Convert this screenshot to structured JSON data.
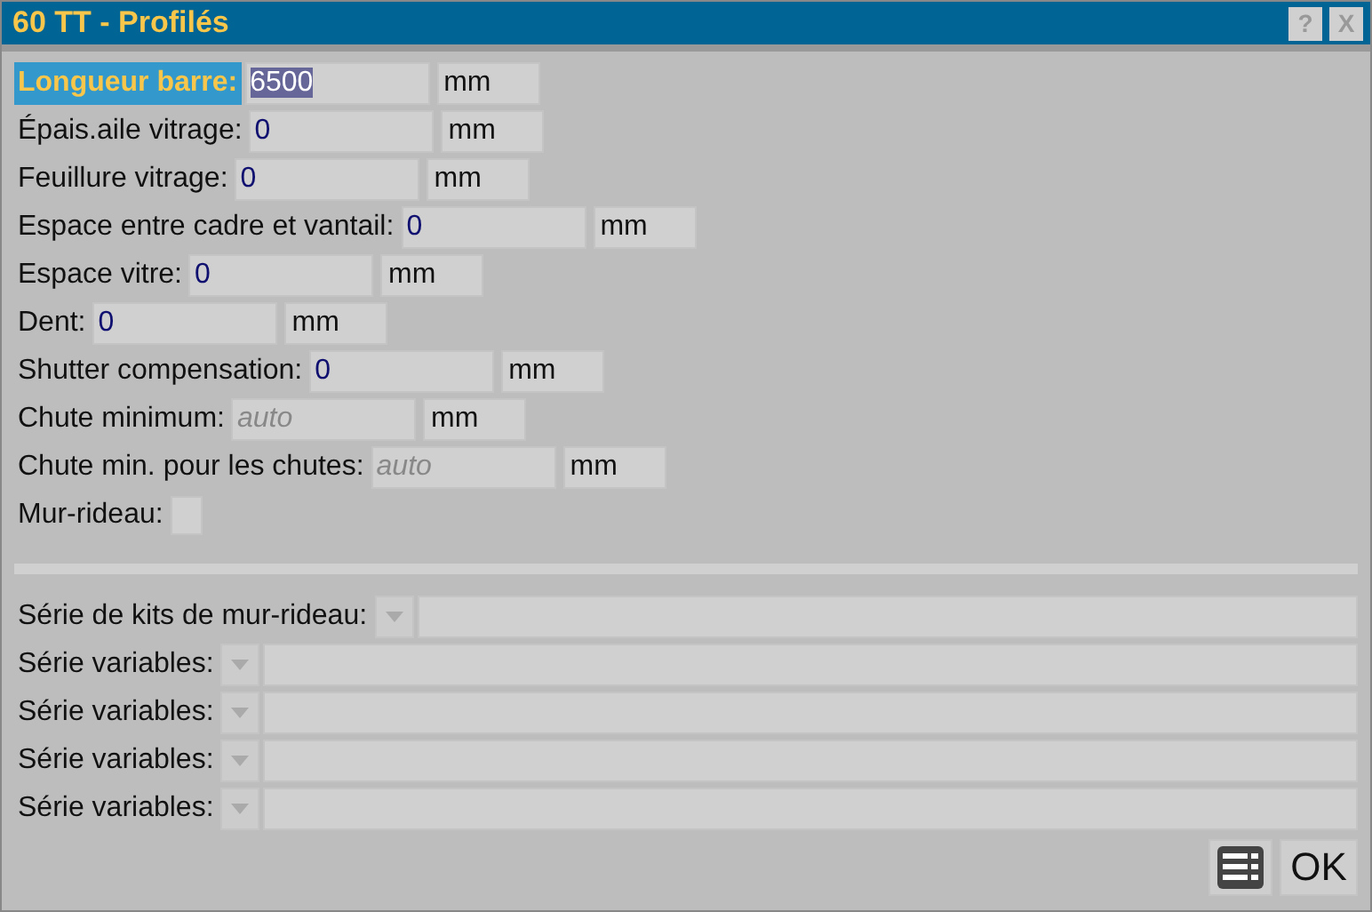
{
  "window": {
    "title": "60 TT - Profilés",
    "help": "?",
    "close": "X"
  },
  "fields": [
    {
      "kind": "number",
      "label": "Longueur barre:",
      "value": "6500",
      "unit": "mm",
      "selected": true
    },
    {
      "kind": "number",
      "label": "Épais.aile vitrage:",
      "value": "0",
      "unit": "mm",
      "selected": false
    },
    {
      "kind": "number",
      "label": "Feuillure vitrage:",
      "value": "0",
      "unit": "mm",
      "selected": false
    },
    {
      "kind": "number",
      "label": "Espace entre cadre et vantail:",
      "value": "0",
      "unit": "mm",
      "selected": false
    },
    {
      "kind": "number",
      "label": "Espace vitre:",
      "value": "0",
      "unit": "mm",
      "selected": false
    },
    {
      "kind": "number",
      "label": "Dent:",
      "value": "0",
      "unit": "mm",
      "selected": false
    },
    {
      "kind": "number",
      "label": "Shutter compensation:",
      "value": "0",
      "unit": "mm",
      "selected": false
    },
    {
      "kind": "number",
      "label": "Chute minimum:",
      "placeholder": "auto",
      "unit": "mm",
      "selected": false
    },
    {
      "kind": "number",
      "label": "Chute min. pour les chutes:",
      "placeholder": "auto",
      "unit": "mm",
      "selected": false
    },
    {
      "kind": "checkbox",
      "label": "Mur-rideau:",
      "checked": false,
      "selected": false
    }
  ],
  "series": [
    {
      "label": "Série de kits de mur-rideau:"
    },
    {
      "label": "Série variables:"
    },
    {
      "label": "Série variables:"
    },
    {
      "label": "Série variables:"
    },
    {
      "label": "Série variables:"
    }
  ],
  "buttons": {
    "ok": "OK"
  }
}
